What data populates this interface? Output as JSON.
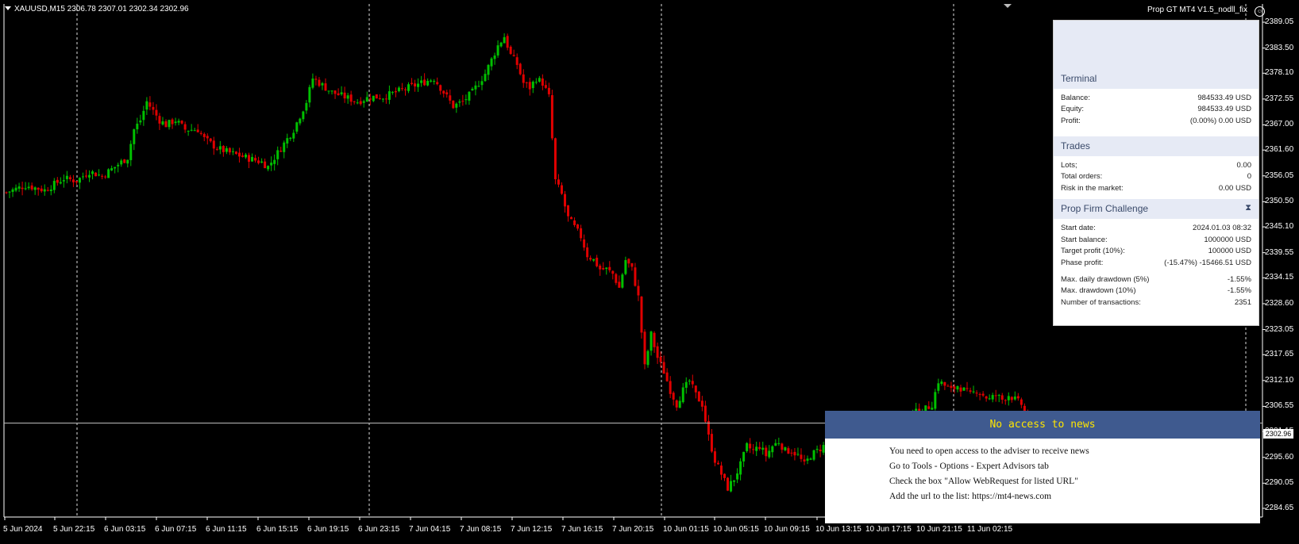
{
  "header": {
    "symbol_info": "XAUUSD,M15  2306.78 2307.01 2302.34 2302.96",
    "ea_name": "Prop GT MT4 V1.5_nodll_fix",
    "ea_icon": "smiley-icon"
  },
  "current_price_label": "2302.96",
  "chart_data": {
    "type": "candlestick",
    "symbol": "XAUUSD",
    "timeframe": "M15",
    "last_bar": {
      "open": 2306.78,
      "high": 2307.01,
      "low": 2302.34,
      "close": 2302.96
    },
    "y_ticks": [
      "2389.05",
      "2383.50",
      "2378.10",
      "2372.55",
      "2367.00",
      "2361.60",
      "2356.05",
      "2350.50",
      "2345.10",
      "2339.55",
      "2334.15",
      "2328.60",
      "2323.05",
      "2317.65",
      "2312.10",
      "2306.55",
      "2301.15",
      "2295.60",
      "2290.05",
      "2284.65"
    ],
    "ylim": [
      2284.65,
      2389.05
    ],
    "x_ticks": [
      "5 Jun 2024",
      "5 Jun 22:15",
      "6 Jun 03:15",
      "6 Jun 07:15",
      "6 Jun 11:15",
      "6 Jun 15:15",
      "6 Jun 19:15",
      "6 Jun 23:15",
      "7 Jun 04:15",
      "7 Jun 08:15",
      "7 Jun 12:15",
      "7 Jun 16:15",
      "7 Jun 20:15",
      "10 Jun 01:15",
      "10 Jun 05:15",
      "10 Jun 09:15",
      "10 Jun 13:15",
      "10 Jun 17:15",
      "10 Jun 21:15",
      "11 Jun 02:15"
    ],
    "close_path": [
      [
        0,
        2352.5
      ],
      [
        6,
        2354
      ],
      [
        12,
        2353
      ],
      [
        18,
        2355.5
      ],
      [
        22,
        2355
      ],
      [
        26,
        2357
      ],
      [
        30,
        2356
      ],
      [
        34,
        2358
      ],
      [
        38,
        2360
      ],
      [
        40,
        2366
      ],
      [
        42,
        2368
      ],
      [
        44,
        2372
      ],
      [
        46,
        2370
      ],
      [
        48,
        2368
      ],
      [
        50,
        2367
      ],
      [
        53,
        2368
      ],
      [
        56,
        2366
      ],
      [
        60,
        2366
      ],
      [
        62,
        2364
      ],
      [
        66,
        2362
      ],
      [
        70,
        2361
      ],
      [
        75,
        2360
      ],
      [
        80,
        2359
      ],
      [
        82,
        2358
      ],
      [
        86,
        2362
      ],
      [
        90,
        2366
      ],
      [
        94,
        2372
      ],
      [
        96,
        2377
      ],
      [
        98,
        2376
      ],
      [
        102,
        2374
      ],
      [
        106,
        2373
      ],
      [
        110,
        2372
      ],
      [
        114,
        2373
      ],
      [
        118,
        2373
      ],
      [
        122,
        2374
      ],
      [
        126,
        2375
      ],
      [
        130,
        2376
      ],
      [
        134,
        2377
      ],
      [
        136,
        2375
      ],
      [
        140,
        2371
      ],
      [
        143,
        2372
      ],
      [
        146,
        2374
      ],
      [
        150,
        2378
      ],
      [
        152,
        2381
      ],
      [
        154,
        2384
      ],
      [
        156,
        2386
      ],
      [
        158,
        2382
      ],
      [
        160,
        2380
      ],
      [
        162,
        2376
      ],
      [
        164,
        2375
      ],
      [
        166,
        2377
      ],
      [
        168,
        2376
      ],
      [
        170,
        2373
      ],
      [
        172,
        2355
      ],
      [
        174,
        2352
      ],
      [
        176,
        2347
      ],
      [
        178,
        2345
      ],
      [
        180,
        2343
      ],
      [
        182,
        2339
      ],
      [
        184,
        2338
      ],
      [
        186,
        2336
      ],
      [
        188,
        2336
      ],
      [
        190,
        2335
      ],
      [
        192,
        2332
      ],
      [
        194,
        2338
      ],
      [
        196,
        2336
      ],
      [
        198,
        2330
      ],
      [
        200,
        2315
      ],
      [
        202,
        2322
      ],
      [
        204,
        2317
      ],
      [
        206,
        2314
      ],
      [
        208,
        2310
      ],
      [
        210,
        2307
      ],
      [
        212,
        2310
      ],
      [
        214,
        2312
      ],
      [
        216,
        2309
      ],
      [
        218,
        2307
      ],
      [
        220,
        2300
      ],
      [
        222,
        2295
      ],
      [
        224,
        2292
      ],
      [
        226,
        2289
      ],
      [
        228,
        2291
      ],
      [
        230,
        2294
      ],
      [
        232,
        2298
      ],
      [
        234,
        2297
      ],
      [
        236,
        2298
      ],
      [
        238,
        2296
      ],
      [
        240,
        2298
      ],
      [
        242,
        2299
      ],
      [
        244,
        2297
      ],
      [
        246,
        2297
      ],
      [
        248,
        2296
      ],
      [
        250,
        2294
      ],
      [
        252,
        2296
      ],
      [
        254,
        2297
      ],
      [
        256,
        2298
      ],
      [
        258,
        2295
      ],
      [
        260,
        2293
      ],
      [
        262,
        2291
      ],
      [
        264,
        2296
      ],
      [
        266,
        2298
      ],
      [
        268,
        2296
      ],
      [
        270,
        2295
      ],
      [
        272,
        2299
      ],
      [
        274,
        2300
      ],
      [
        276,
        2298
      ],
      [
        280,
        2302
      ],
      [
        284,
        2305
      ],
      [
        288,
        2306
      ],
      [
        290,
        2307
      ],
      [
        292,
        2312
      ],
      [
        294,
        2311
      ],
      [
        296,
        2310
      ],
      [
        298,
        2311
      ],
      [
        300,
        2310
      ],
      [
        302,
        2309
      ],
      [
        304,
        2310
      ],
      [
        306,
        2309
      ],
      [
        308,
        2308
      ],
      [
        310,
        2309
      ],
      [
        312,
        2308
      ],
      [
        314,
        2309
      ],
      [
        316,
        2308
      ],
      [
        318,
        2307
      ],
      [
        320,
        2303
      ]
    ]
  },
  "terminal": {
    "title": "Terminal",
    "rows": [
      {
        "k": "Balance:",
        "v": "984533.49 USD"
      },
      {
        "k": "Equity:",
        "v": "984533.49 USD"
      },
      {
        "k": "Profit:",
        "v": "(0.00%) 0.00 USD"
      }
    ]
  },
  "trades": {
    "title": "Trades",
    "rows": [
      {
        "k": "Lots;",
        "v": "0.00"
      },
      {
        "k": "Total orders:",
        "v": "0"
      },
      {
        "k": "Risk in the market:",
        "v": "0.00 USD"
      }
    ]
  },
  "challenge": {
    "title": "Prop Firm Challenge",
    "icon": "hourglass-icon",
    "rows": [
      {
        "k": "Start date:",
        "v": "2024.01.03 08:32"
      },
      {
        "k": "Start balance:",
        "v": "1000000 USD"
      },
      {
        "k": "Target profit (10%):",
        "v": "100000 USD"
      },
      {
        "k": "Phase profit:",
        "v": "(-15.47%) -15466.51 USD"
      },
      {
        "k": "Max. daily drawdown (5%)",
        "v": "-1.55%"
      },
      {
        "k": "Max. drawdown (10%)",
        "v": "-1.55%"
      },
      {
        "k": "Number of transactions:",
        "v": "2351"
      }
    ]
  },
  "news": {
    "title": "No access to news",
    "lines": [
      "You need to open access to the adviser to receive news",
      "Go to Tools - Options - Expert Advisors tab",
      "Check the box \"Allow WebRequest for listed URL\"",
      "Add the url to the list: https://mt4-news.com"
    ]
  },
  "colors": {
    "background": "#000000",
    "bull": "#00c000",
    "bear": "#e00000",
    "panel_header": "#e6eaf5",
    "news_bar": "#3f5a8f",
    "news_title": "#ffe600"
  }
}
